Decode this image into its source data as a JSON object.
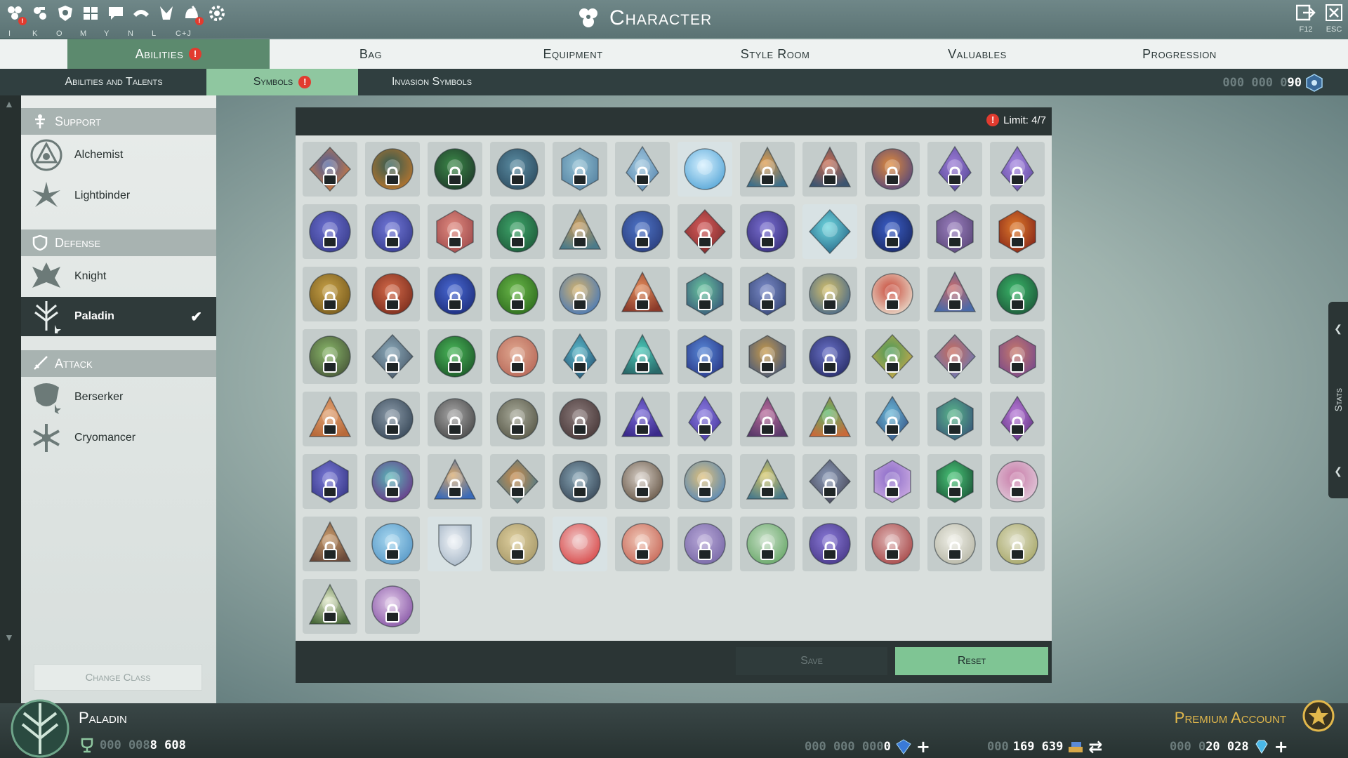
{
  "window": {
    "title": "Character",
    "hotkeys": [
      "I",
      "K",
      "O",
      "M",
      "Y",
      "N",
      "L",
      "C+J"
    ],
    "fullscreen_key": "F12",
    "close_key": "ESC"
  },
  "main_tabs": [
    {
      "label": "Abilities",
      "active": true,
      "alert": "!"
    },
    {
      "label": "Bag"
    },
    {
      "label": "Equipment"
    },
    {
      "label": "Style Room"
    },
    {
      "label": "Valuables"
    },
    {
      "label": "Progression"
    }
  ],
  "sub_tabs": [
    {
      "label": "Abilities and Talents"
    },
    {
      "label": "Symbols",
      "active": true,
      "alert": "!"
    },
    {
      "label": "Invasion Symbols"
    }
  ],
  "top_counter": {
    "dim": "000 000 0",
    "bright": "90"
  },
  "sidebar": {
    "categories": [
      {
        "label": "Support",
        "classes": [
          "Alchemist",
          "Lightbinder"
        ]
      },
      {
        "label": "Defense",
        "classes": [
          "Knight",
          "Paladin"
        ]
      },
      {
        "label": "Attack",
        "classes": [
          "Berserker",
          "Cryomancer"
        ]
      }
    ],
    "selected_class": "Paladin",
    "change_class_label": "Change Class"
  },
  "panel": {
    "limit_label": "Limit: 4/7",
    "save_label": "Save",
    "reset_label": "Reset"
  },
  "stats_label": "Stats",
  "bottom": {
    "class_name": "Paladin",
    "premium_label": "Premium Account",
    "level_dim": "000 008",
    "level_bright": "8 608",
    "cur1_dim": "000 000 000",
    "cur1_bright": "0",
    "cur2_dim": "000",
    "cur2_bright": "169 639",
    "cur3_dim": "000 0",
    "cur3_bright": "20 028"
  },
  "colors": {
    "accent_green": "#5c8a6e",
    "subtab_active": "#8fc7a0",
    "reset_button": "#7fc594",
    "alert_red": "#e23b2f",
    "premium_gold": "#e2b84c"
  },
  "symbols": [
    {
      "name": "runner-symbol",
      "c1": "#4a5f9c",
      "c2": "#d47b3a",
      "shape": "diamond",
      "locked": true
    },
    {
      "name": "tree-symbol",
      "c1": "#2f5a52",
      "c2": "#b7752e",
      "shape": "round",
      "locked": true
    },
    {
      "name": "ring-symbol",
      "c1": "#3c8a49",
      "c2": "#1f3b2a",
      "shape": "round",
      "locked": true
    },
    {
      "name": "orb-symbol",
      "c1": "#5b8da3",
      "c2": "#2e4e62",
      "shape": "round",
      "locked": true
    },
    {
      "name": "cube-symbol",
      "c1": "#8fbfd3",
      "c2": "#5a86a4",
      "shape": "hex",
      "locked": true
    },
    {
      "name": "crystal-symbol",
      "c1": "#9fc7df",
      "c2": "#5f8cb2",
      "shape": "spire",
      "locked": true
    },
    {
      "name": "lightburst-symbol",
      "c1": "#d7f1ff",
      "c2": "#5aa8d8",
      "shape": "round",
      "locked": false
    },
    {
      "name": "flame-peak-symbol",
      "c1": "#e09a4a",
      "c2": "#3e6f8a",
      "shape": "tri",
      "locked": true
    },
    {
      "name": "dome-symbol",
      "c1": "#c86a4f",
      "c2": "#3c5570",
      "shape": "tri",
      "locked": true
    },
    {
      "name": "sunburst-symbol",
      "c1": "#e08a3a",
      "c2": "#5a4a7a",
      "shape": "round",
      "locked": true
    },
    {
      "name": "violet-gem-symbol",
      "c1": "#9b7ad6",
      "c2": "#5a4c9a",
      "shape": "spire",
      "locked": true
    },
    {
      "name": "violet-peak-symbol",
      "c1": "#a586e0",
      "c2": "#6a52a8",
      "shape": "spire",
      "locked": true
    },
    {
      "name": "shield-orb-symbol",
      "c1": "#6b6fd0",
      "c2": "#3b3f8e",
      "shape": "round",
      "locked": true
    },
    {
      "name": "shield-orb-2-symbol",
      "c1": "#7178d8",
      "c2": "#3a3f92",
      "shape": "round",
      "locked": true
    },
    {
      "name": "red-gem-symbol",
      "c1": "#e08a80",
      "c2": "#a24e4e",
      "shape": "hex",
      "locked": true
    },
    {
      "name": "green-cross-symbol",
      "c1": "#3fa66b",
      "c2": "#1e5d3b",
      "shape": "round",
      "locked": true
    },
    {
      "name": "fist-peak-symbol",
      "c1": "#c89a5a",
      "c2": "#4c7b8a",
      "shape": "tri",
      "locked": true
    },
    {
      "name": "blue-runner-symbol",
      "c1": "#4d74c8",
      "c2": "#2c3f7e",
      "shape": "round",
      "locked": true
    },
    {
      "name": "red-runner-symbol",
      "c1": "#d45a5a",
      "c2": "#7e2c2c",
      "shape": "diamond",
      "locked": true
    },
    {
      "name": "violet-runner-symbol",
      "c1": "#7a6fd2",
      "c2": "#3b337e",
      "shape": "round",
      "locked": true
    },
    {
      "name": "cyan-runner-symbol",
      "c1": "#6fd8e0",
      "c2": "#2a6a8a",
      "shape": "diamond",
      "locked": false
    },
    {
      "name": "blue-arrow-symbol",
      "c1": "#3b5fc8",
      "c2": "#1c2c6a",
      "shape": "round",
      "locked": true
    },
    {
      "name": "violet-beast-symbol",
      "c1": "#9a7fbf",
      "c2": "#5e4a7c",
      "shape": "hex",
      "locked": true
    },
    {
      "name": "fire-giant-symbol",
      "c1": "#e07a2a",
      "c2": "#8a2a1a",
      "shape": "hex",
      "locked": true
    },
    {
      "name": "gold-fist-symbol",
      "c1": "#c8a248",
      "c2": "#7a5d1e",
      "shape": "round",
      "locked": true
    },
    {
      "name": "red-fist-symbol",
      "c1": "#d46a4a",
      "c2": "#7e2f1e",
      "shape": "round",
      "locked": true
    },
    {
      "name": "blue-fist-symbol",
      "c1": "#4a6ad4",
      "c2": "#1e2f7e",
      "shape": "round",
      "locked": true
    },
    {
      "name": "green-fist-symbol",
      "c1": "#6ab84a",
      "c2": "#2f6e1e",
      "shape": "round",
      "locked": true
    },
    {
      "name": "wing-symbol",
      "c1": "#d8b46a",
      "c2": "#4a7ab8",
      "shape": "round",
      "locked": true
    },
    {
      "name": "ember-peak-symbol",
      "c1": "#e08a5a",
      "c2": "#8a3a2a",
      "shape": "tri",
      "locked": true
    },
    {
      "name": "emerald-peak-symbol",
      "c1": "#6ac8a0",
      "c2": "#3a5a7a",
      "shape": "hex",
      "locked": true
    },
    {
      "name": "honeycomb-symbol",
      "c1": "#7a8ac8",
      "c2": "#3a4a7a",
      "shape": "hex",
      "locked": true
    },
    {
      "name": "gold-orbit-symbol",
      "c1": "#d8c26a",
      "c2": "#4a6a8a",
      "shape": "round",
      "locked": true
    },
    {
      "name": "skull-symbol",
      "c1": "#c84a3a",
      "c2": "#e8d8c8",
      "shape": "round",
      "locked": true
    },
    {
      "name": "tower-peak-symbol",
      "c1": "#c86a6a",
      "c2": "#4a6aa8",
      "shape": "tri",
      "locked": true
    },
    {
      "name": "green-gear-symbol",
      "c1": "#3ab86a",
      "c2": "#1e5a3a",
      "shape": "round",
      "locked": true
    },
    {
      "name": "lantern-symbol",
      "c1": "#8ab86a",
      "c2": "#4a5a3a",
      "shape": "round",
      "locked": true
    },
    {
      "name": "cannon-symbol",
      "c1": "#8aa8b8",
      "c2": "#4a5a6a",
      "shape": "diamond",
      "locked": true
    },
    {
      "name": "green-hex-symbol",
      "c1": "#4ab85a",
      "c2": "#1e5a2a",
      "shape": "round",
      "locked": true
    },
    {
      "name": "star-symbol",
      "c1": "#e0a890",
      "c2": "#b86a5a",
      "shape": "round",
      "locked": true
    },
    {
      "name": "teal-spire-symbol",
      "c1": "#5ab8c8",
      "c2": "#2a5a7a",
      "shape": "spire",
      "locked": true
    },
    {
      "name": "teal-peak-symbol",
      "c1": "#4ac8b8",
      "c2": "#2a6a6a",
      "shape": "tri",
      "locked": true
    },
    {
      "name": "blue-hex-symbol",
      "c1": "#5a8ad8",
      "c2": "#2a3a8a",
      "shape": "hex",
      "locked": true
    },
    {
      "name": "honey-peak-symbol",
      "c1": "#c89a4a",
      "c2": "#4a5a7a",
      "shape": "hex",
      "locked": true
    },
    {
      "name": "moon-orb-symbol",
      "c1": "#6a72c8",
      "c2": "#2a2f6a",
      "shape": "round",
      "locked": true
    },
    {
      "name": "serpent-symbol",
      "c1": "#4a9a5a",
      "c2": "#c8a84a",
      "shape": "diamond",
      "locked": true
    },
    {
      "name": "sword-diamond-symbol",
      "c1": "#c86a5a",
      "c2": "#6a7ab8",
      "shape": "diamond",
      "locked": true
    },
    {
      "name": "titan-symbol",
      "c1": "#c87a6a",
      "c2": "#7a4a8a",
      "shape": "hex",
      "locked": true
    },
    {
      "name": "copper-peak-symbol",
      "c1": "#e0a070",
      "c2": "#b86a3a",
      "shape": "tri",
      "locked": true
    },
    {
      "name": "steel-ring-symbol",
      "c1": "#8a9aa8",
      "c2": "#3a4a5a",
      "shape": "round",
      "locked": true
    },
    {
      "name": "sword-ring-symbol",
      "c1": "#a8a8a8",
      "c2": "#4a4a4a",
      "shape": "round",
      "locked": true
    },
    {
      "name": "stone-ring-symbol",
      "c1": "#a8aa9a",
      "c2": "#5a5a4a",
      "shape": "round",
      "locked": true
    },
    {
      "name": "blade-ring-symbol",
      "c1": "#8a7a7a",
      "c2": "#4a3a3a",
      "shape": "round",
      "locked": true
    },
    {
      "name": "indigo-peak-symbol",
      "c1": "#7a6ad8",
      "c2": "#3a2a8a",
      "shape": "tri",
      "locked": true
    },
    {
      "name": "violet-ring-peak-symbol",
      "c1": "#8a7ae0",
      "c2": "#4a3aa0",
      "shape": "spire",
      "locked": true
    },
    {
      "name": "plum-peak-symbol",
      "c1": "#b86a9a",
      "c2": "#5a3a6a",
      "shape": "tri",
      "locked": true
    },
    {
      "name": "green-peak-symbol",
      "c1": "#5ab86a",
      "c2": "#c86a3a",
      "shape": "tri",
      "locked": true
    },
    {
      "name": "ice-peak-symbol",
      "c1": "#6ab8d8",
      "c2": "#3a5a8a",
      "shape": "spire",
      "locked": true
    },
    {
      "name": "jade-hex-symbol",
      "c1": "#5ab88a",
      "c2": "#3a5a7a",
      "shape": "hex",
      "locked": true
    },
    {
      "name": "orchid-peak-symbol",
      "c1": "#b87ad8",
      "c2": "#6a3a8a",
      "shape": "spire",
      "locked": true
    },
    {
      "name": "crystal-hex-symbol",
      "c1": "#7a7ad8",
      "c2": "#3a3a8a",
      "shape": "hex",
      "locked": true
    },
    {
      "name": "clover-symbol",
      "c1": "#5ab8b8",
      "c2": "#6a3a8a",
      "shape": "round",
      "locked": true
    },
    {
      "name": "eye-symbol",
      "c1": "#d8a86a",
      "c2": "#3a6ab8",
      "shape": "tri",
      "locked": true
    },
    {
      "name": "archer-symbol",
      "c1": "#c88a4a",
      "c2": "#4a7a8a",
      "shape": "diamond",
      "locked": true
    },
    {
      "name": "dragon-ring-symbol",
      "c1": "#8aa8b8",
      "c2": "#3a4a5a",
      "shape": "round",
      "locked": true
    },
    {
      "name": "cross-ring-symbol",
      "c1": "#d8d0c8",
      "c2": "#6a5a4a",
      "shape": "round",
      "locked": true
    },
    {
      "name": "dawn-symbol",
      "c1": "#e0c07a",
      "c2": "#5a8ab8",
      "shape": "round",
      "locked": true
    },
    {
      "name": "gold-peak-symbol",
      "c1": "#d8c86a",
      "c2": "#4a7a8a",
      "shape": "tri",
      "locked": true
    },
    {
      "name": "armor-symbol",
      "c1": "#8a9ab8",
      "c2": "#4a4a5a",
      "shape": "diamond",
      "locked": true
    },
    {
      "name": "violet-crown-symbol",
      "c1": "#8a6ac8",
      "c2": "#c8a8e0",
      "shape": "hex",
      "locked": true
    },
    {
      "name": "green-idol-symbol",
      "c1": "#4ac87a",
      "c2": "#1e5a3a",
      "shape": "hex",
      "locked": true
    },
    {
      "name": "rose-wheel-symbol",
      "c1": "#c87aa8",
      "c2": "#e0c8d8",
      "shape": "round",
      "locked": true
    },
    {
      "name": "bronze-eye-symbol",
      "c1": "#c89a6a",
      "c2": "#6a4a3a",
      "shape": "tri",
      "locked": true
    },
    {
      "name": "snowflake-symbol",
      "c1": "#a8d8f0",
      "c2": "#5a9ac8",
      "shape": "round",
      "locked": true
    },
    {
      "name": "white-sword-symbol",
      "c1": "#f0f4f8",
      "c2": "#a8b8c8",
      "shape": "shield",
      "locked": false
    },
    {
      "name": "winged-gold-symbol",
      "c1": "#e0d0a0",
      "c2": "#a89a6a",
      "shape": "round",
      "locked": true
    },
    {
      "name": "red-heart-symbol",
      "c1": "#f0c8c8",
      "c2": "#d84a4a",
      "shape": "round",
      "locked": false
    },
    {
      "name": "pale-star-symbol",
      "c1": "#f0c8b8",
      "c2": "#c86a5a",
      "shape": "round",
      "locked": true
    },
    {
      "name": "chain-ring-symbol",
      "c1": "#b8a8d8",
      "c2": "#7a6aa8",
      "shape": "round",
      "locked": true
    },
    {
      "name": "leaf-cross-symbol",
      "c1": "#c8e0c8",
      "c2": "#6aa86a",
      "shape": "round",
      "locked": true
    },
    {
      "name": "swirl-symbol",
      "c1": "#8a7ad8",
      "c2": "#4a3a8a",
      "shape": "round",
      "locked": true
    },
    {
      "name": "star-ring-symbol",
      "c1": "#e0b8b8",
      "c2": "#a84a4a",
      "shape": "round",
      "locked": true
    },
    {
      "name": "white-wings-symbol",
      "c1": "#f0f0e8",
      "c2": "#b8b8a8",
      "shape": "round",
      "locked": true
    },
    {
      "name": "knot-symbol",
      "c1": "#e0e0c8",
      "c2": "#a8a86a",
      "shape": "round",
      "locked": true
    },
    {
      "name": "flask-symbol",
      "c1": "#e0e8c8",
      "c2": "#4a6a3a",
      "shape": "tri",
      "locked": true
    },
    {
      "name": "rune-circle-symbol",
      "c1": "#e0c8e8",
      "c2": "#8a5aa8",
      "shape": "round",
      "locked": true
    }
  ]
}
